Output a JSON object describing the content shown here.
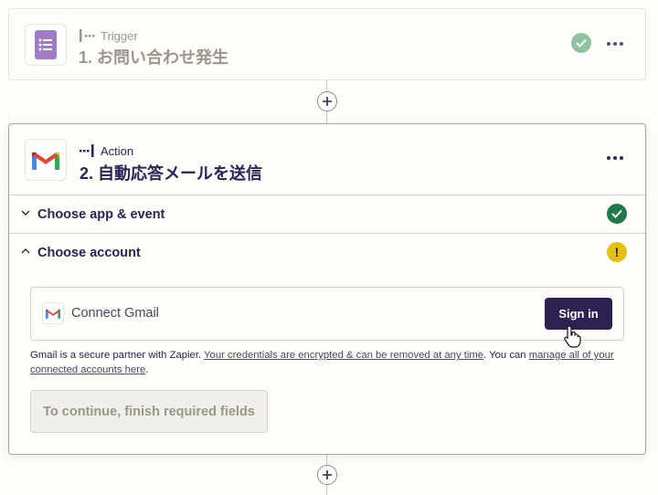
{
  "trigger": {
    "kind_label": "Trigger",
    "title": "1. お問い合わせ発生",
    "app_icon": "google-forms-icon",
    "status": "complete"
  },
  "action": {
    "kind_label": "Action",
    "title": "2. 自動応答メールを送信",
    "app_icon": "gmail-icon",
    "sections": [
      {
        "label": "Choose app & event",
        "state": "collapsed",
        "status": "complete"
      },
      {
        "label": "Choose account",
        "state": "expanded",
        "status": "warning"
      }
    ],
    "account": {
      "connect_label": "Connect Gmail",
      "signin_label": "Sign in",
      "note_prefix": "Gmail is a secure partner with Zapier. ",
      "note_link1": "Your credentials are encrypted & can be removed at any time",
      "note_middle": ". You can ",
      "note_link2": "manage all of your connected accounts here",
      "note_suffix": "."
    },
    "continue_label": "To continue, finish required fields"
  },
  "colors": {
    "primary": "#2d2152",
    "success": "#1f7a4a",
    "warning": "#e3c113",
    "background": "#fffdf9"
  }
}
